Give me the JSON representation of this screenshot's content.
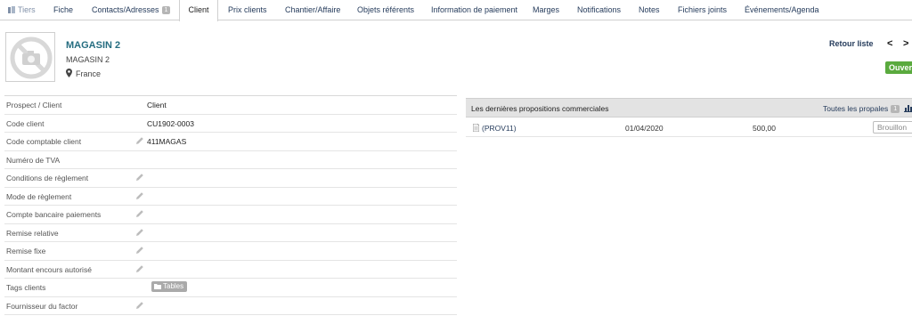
{
  "tabs": [
    {
      "label": "Tiers",
      "icon": "company-icon"
    },
    {
      "label": "Fiche"
    },
    {
      "label": "Contacts/Adresses",
      "badge": "1"
    },
    {
      "label": "Client"
    },
    {
      "label": "Prix clients"
    },
    {
      "label": "Chantier/Affaire"
    },
    {
      "label": "Objets référents"
    },
    {
      "label": "Information de paiement"
    },
    {
      "label": "Marges"
    },
    {
      "label": "Notifications"
    },
    {
      "label": "Notes"
    },
    {
      "label": "Fichiers joints"
    },
    {
      "label": "Événements/Agenda"
    }
  ],
  "active_tab": "Client",
  "card": {
    "name": "MAGASIN 2",
    "alias": "MAGASIN 2",
    "country": "France",
    "photo_icon": "no-photo-icon"
  },
  "nav": {
    "back_label": "Retour liste",
    "prev_label": "<",
    "next_label": ">",
    "status": "Ouvert"
  },
  "fields": [
    {
      "label": "Prospect / Client",
      "value": "Client"
    },
    {
      "label": "Code client",
      "value": "CU1902-0003"
    },
    {
      "label": "Code comptable client",
      "value": "411MAGAS",
      "editable": true
    },
    {
      "label": "Numéro de TVA",
      "value": ""
    },
    {
      "label": "Conditions de règlement",
      "value": "",
      "editable": true
    },
    {
      "label": "Mode de règlement",
      "value": "",
      "editable": true
    },
    {
      "label": "Compte bancaire paiements",
      "value": "",
      "editable": true
    },
    {
      "label": "Remise relative",
      "value": "",
      "editable": true
    },
    {
      "label": "Remise fixe",
      "value": "",
      "editable": true
    },
    {
      "label": "Montant encours autorisé",
      "value": "",
      "editable": true
    },
    {
      "label": "Tags clients",
      "tag": "Tables"
    },
    {
      "label": "Fournisseur du factor",
      "value": "",
      "editable": true
    }
  ],
  "proposals": {
    "title": "Les dernières propositions commerciales",
    "all_link": "Toutes les propales",
    "all_count": "1",
    "rows": [
      {
        "ref": "(PROV11)",
        "date": "01/04/2020",
        "amount": "500,00",
        "status": "Brouillon"
      }
    ]
  },
  "colors": {
    "link": "#263c5c",
    "title": "#256d80",
    "status_open": "#5aaa3e",
    "header_bg": "#e3e3e3"
  }
}
